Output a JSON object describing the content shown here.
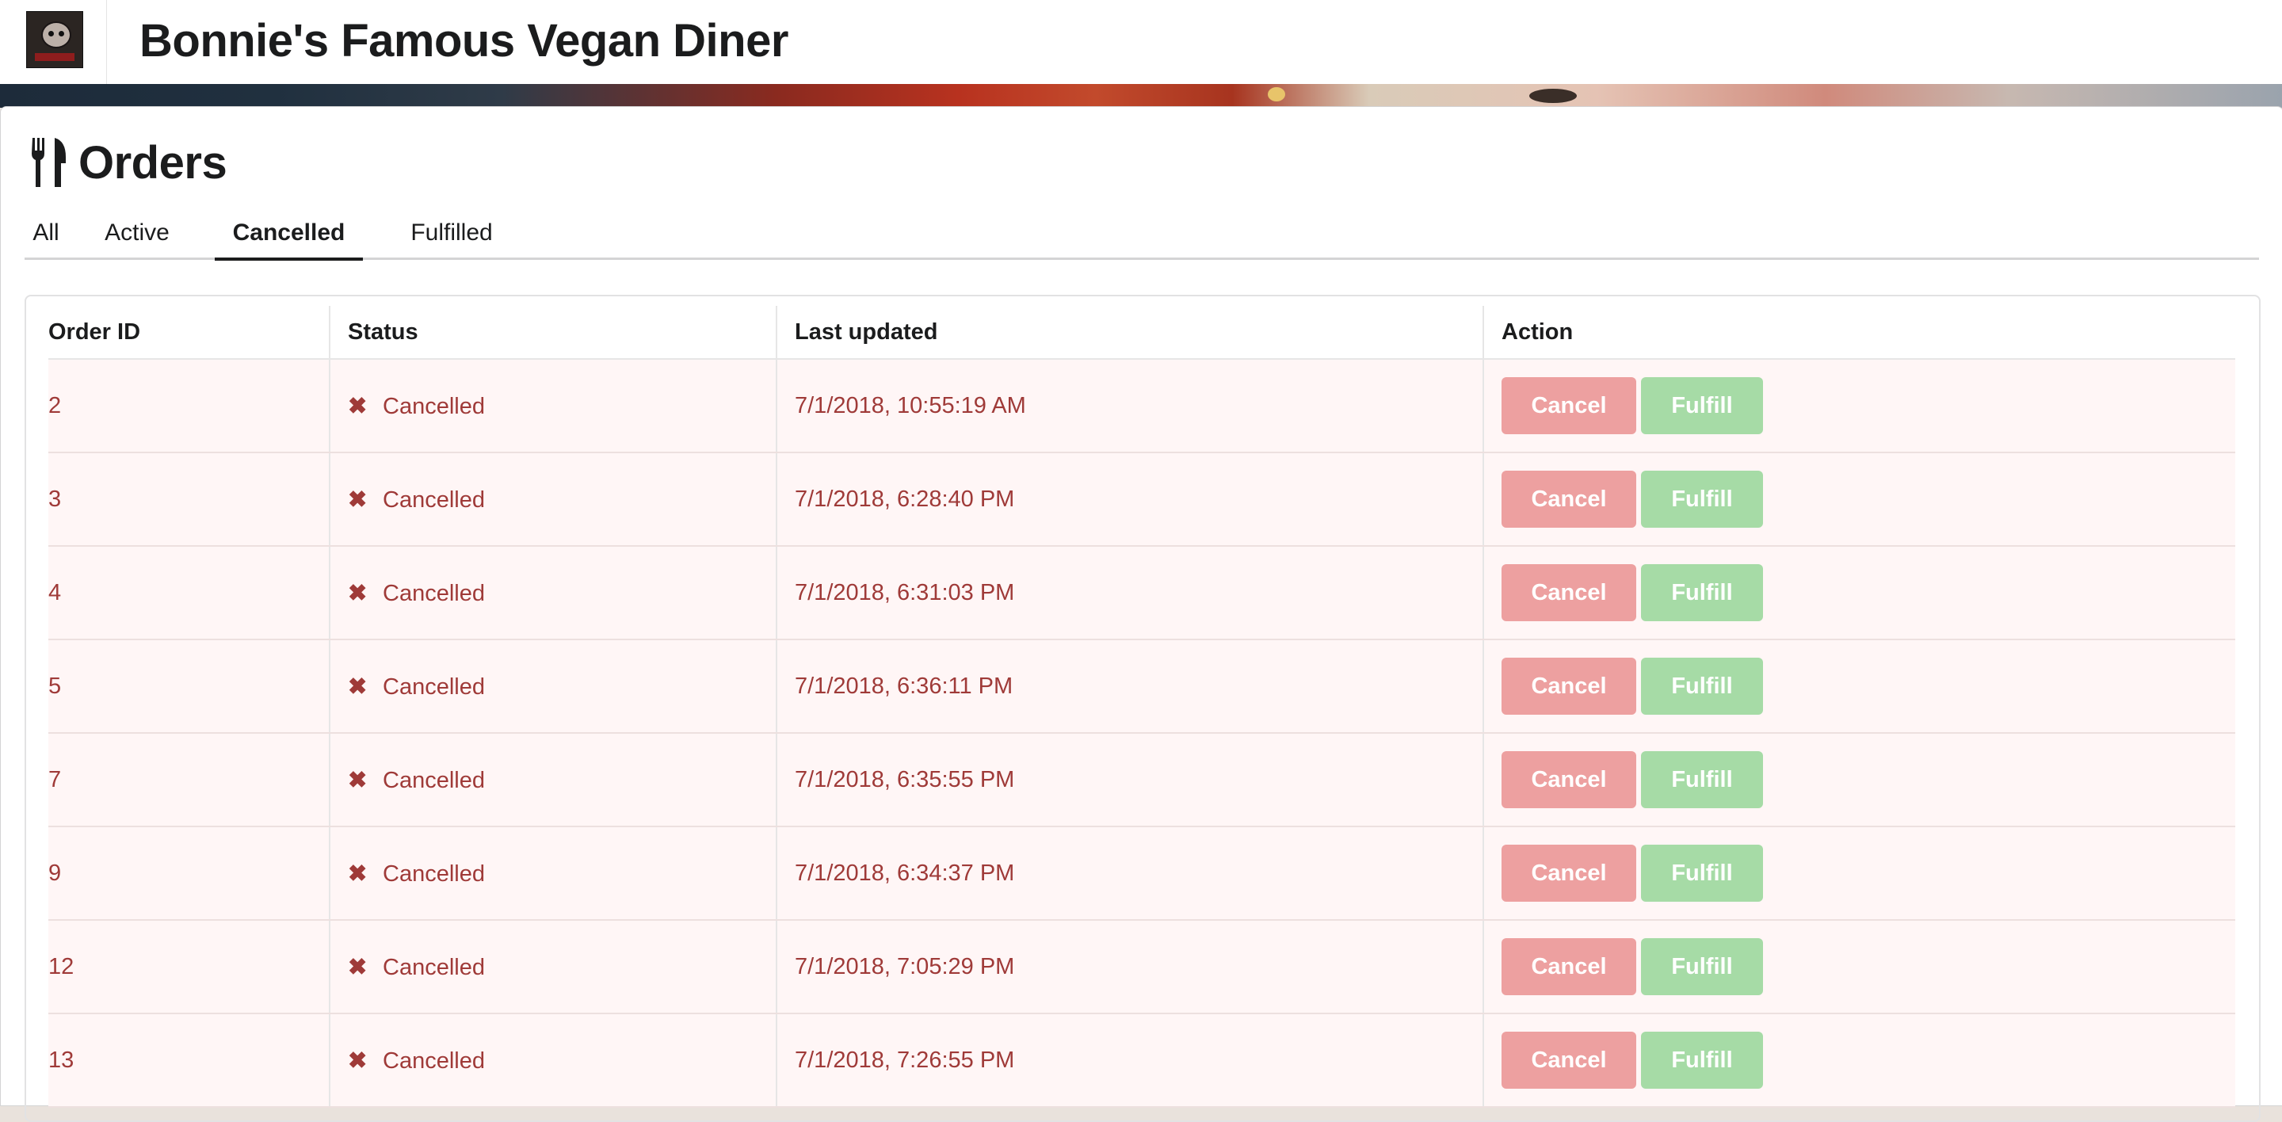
{
  "app": {
    "title": "Bonnie's Famous Vegan Diner",
    "logo_icon": "diner-logo-icon"
  },
  "page": {
    "title": "Orders",
    "title_icon": "fork-knife-icon"
  },
  "tabs": [
    {
      "label": "All",
      "active": false
    },
    {
      "label": "Active",
      "active": false
    },
    {
      "label": "Cancelled",
      "active": true
    },
    {
      "label": "Fulfilled",
      "active": false
    }
  ],
  "table": {
    "columns": [
      "Order ID",
      "Status",
      "Last updated",
      "Action"
    ],
    "rows": [
      {
        "id": "2",
        "status": "Cancelled",
        "updated": "7/1/2018, 10:55:19 AM"
      },
      {
        "id": "3",
        "status": "Cancelled",
        "updated": "7/1/2018, 6:28:40 PM"
      },
      {
        "id": "4",
        "status": "Cancelled",
        "updated": "7/1/2018, 6:31:03 PM"
      },
      {
        "id": "5",
        "status": "Cancelled",
        "updated": "7/1/2018, 6:36:11 PM"
      },
      {
        "id": "7",
        "status": "Cancelled",
        "updated": "7/1/2018, 6:35:55 PM"
      },
      {
        "id": "9",
        "status": "Cancelled",
        "updated": "7/1/2018, 6:34:37 PM"
      },
      {
        "id": "12",
        "status": "Cancelled",
        "updated": "7/1/2018, 7:05:29 PM"
      },
      {
        "id": "13",
        "status": "Cancelled",
        "updated": "7/1/2018, 7:26:55 PM"
      }
    ],
    "status_icon": "cancel-x-icon",
    "status_glyph": "✖",
    "actions": {
      "cancel_label": "Cancel",
      "fulfill_label": "Fulfill"
    }
  },
  "colors": {
    "row_text": "#9f3a38",
    "row_background": "#fff6f6",
    "cancel_button": "#eda0a0",
    "fulfill_button": "#a6dba6"
  }
}
